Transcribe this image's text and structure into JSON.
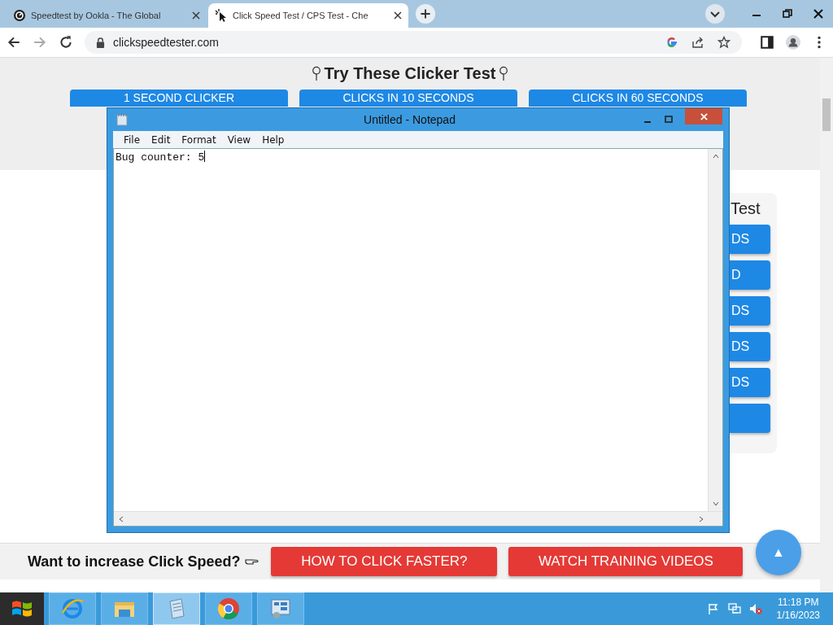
{
  "browser": {
    "tabs": [
      {
        "title": "Speedtest by Ookla - The Global",
        "selected": false
      },
      {
        "title": "Click Speed Test / CPS Test - Che",
        "selected": true
      }
    ],
    "url": "clickspeedtester.com"
  },
  "page": {
    "heading": "Try These Clicker Test",
    "top_buttons": [
      "1 SECOND CLICKER",
      "CLICKS IN 10 SECONDS",
      "CLICKS IN 60 SECONDS"
    ],
    "side_panel": {
      "title": "Test",
      "buttons": [
        {
          "kind": "labeled",
          "label": "DS"
        },
        {
          "kind": "labeled",
          "label": "D"
        },
        {
          "kind": "labeled",
          "label": "DS"
        },
        {
          "kind": "labeled",
          "label": "DS"
        },
        {
          "kind": "labeled",
          "label": "DS"
        },
        {
          "kind": "blank"
        }
      ]
    },
    "bottom_bar": {
      "prompt": "Want to increase Click Speed?",
      "buttons": [
        "HOW TO CLICK FASTER?",
        "WATCH TRAINING VIDEOS"
      ],
      "scroll_top": "▲"
    }
  },
  "notepad": {
    "title": "Untitled - Notepad",
    "menu": [
      "File",
      "Edit",
      "Format",
      "View",
      "Help"
    ],
    "text": "Bug counter: 5"
  },
  "taskbar": {
    "apps": [
      {
        "kind": "ie",
        "selected": false
      },
      {
        "kind": "folder",
        "selected": false
      },
      {
        "kind": "notepad",
        "selected": true
      },
      {
        "kind": "chrome",
        "selected": false
      },
      {
        "kind": "control",
        "selected": false
      }
    ],
    "time": "11:18 PM",
    "date": "1/16/2023"
  }
}
